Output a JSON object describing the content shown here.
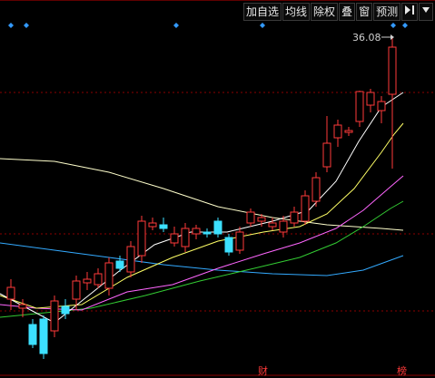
{
  "toolbar": {
    "buttons": [
      {
        "label": "加自选"
      },
      {
        "label": "均线"
      },
      {
        "label": "除权"
      },
      {
        "label": "叠"
      },
      {
        "label": "窗"
      },
      {
        "label": "预测"
      }
    ],
    "icons": [
      "collapse-right-icon",
      "scroll-down-icon"
    ]
  },
  "price_marker": {
    "label": "36.08"
  },
  "bottom_tags": [
    "财",
    "榜"
  ],
  "colors": {
    "up": "#ff3a3a",
    "down": "#3ce0ff",
    "ma5": "#ffffff",
    "ma10": "#ffff66",
    "ma20": "#ff66ff",
    "ma30": "#33cc33",
    "ma60": "#ffffcc",
    "ma120": "#33aaff",
    "grid": "#8b0000",
    "marker": "#3399ff"
  }
}
